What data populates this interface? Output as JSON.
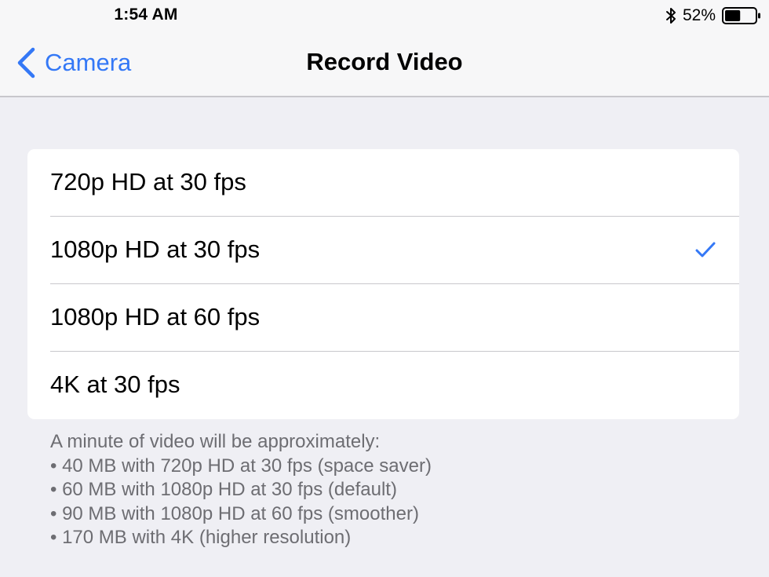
{
  "status_bar": {
    "time": "1:54 AM",
    "battery_percent": "52%",
    "battery_level": 0.52,
    "icons": [
      "bluetooth-icon",
      "battery-icon"
    ]
  },
  "nav": {
    "back_label": "Camera",
    "title": "Record Video"
  },
  "options": [
    {
      "label": "720p HD at 30 fps",
      "selected": false
    },
    {
      "label": "1080p HD at 30 fps",
      "selected": true
    },
    {
      "label": "1080p HD at 60 fps",
      "selected": false
    },
    {
      "label": "4K at 30 fps",
      "selected": false
    }
  ],
  "footer": {
    "intro": "A minute of video will be approximately:",
    "lines": [
      "• 40 MB with 720p HD at 30 fps (space saver)",
      "• 60 MB with 1080p HD at 30 fps (default)",
      "• 90 MB with 1080p HD at 60 fps (smoother)",
      "• 170 MB with 4K (higher resolution)"
    ]
  },
  "colors": {
    "accent": "#3478f6",
    "background": "#efeff4",
    "separator": "#c8c7cc",
    "footer_text": "#6d6d72"
  }
}
